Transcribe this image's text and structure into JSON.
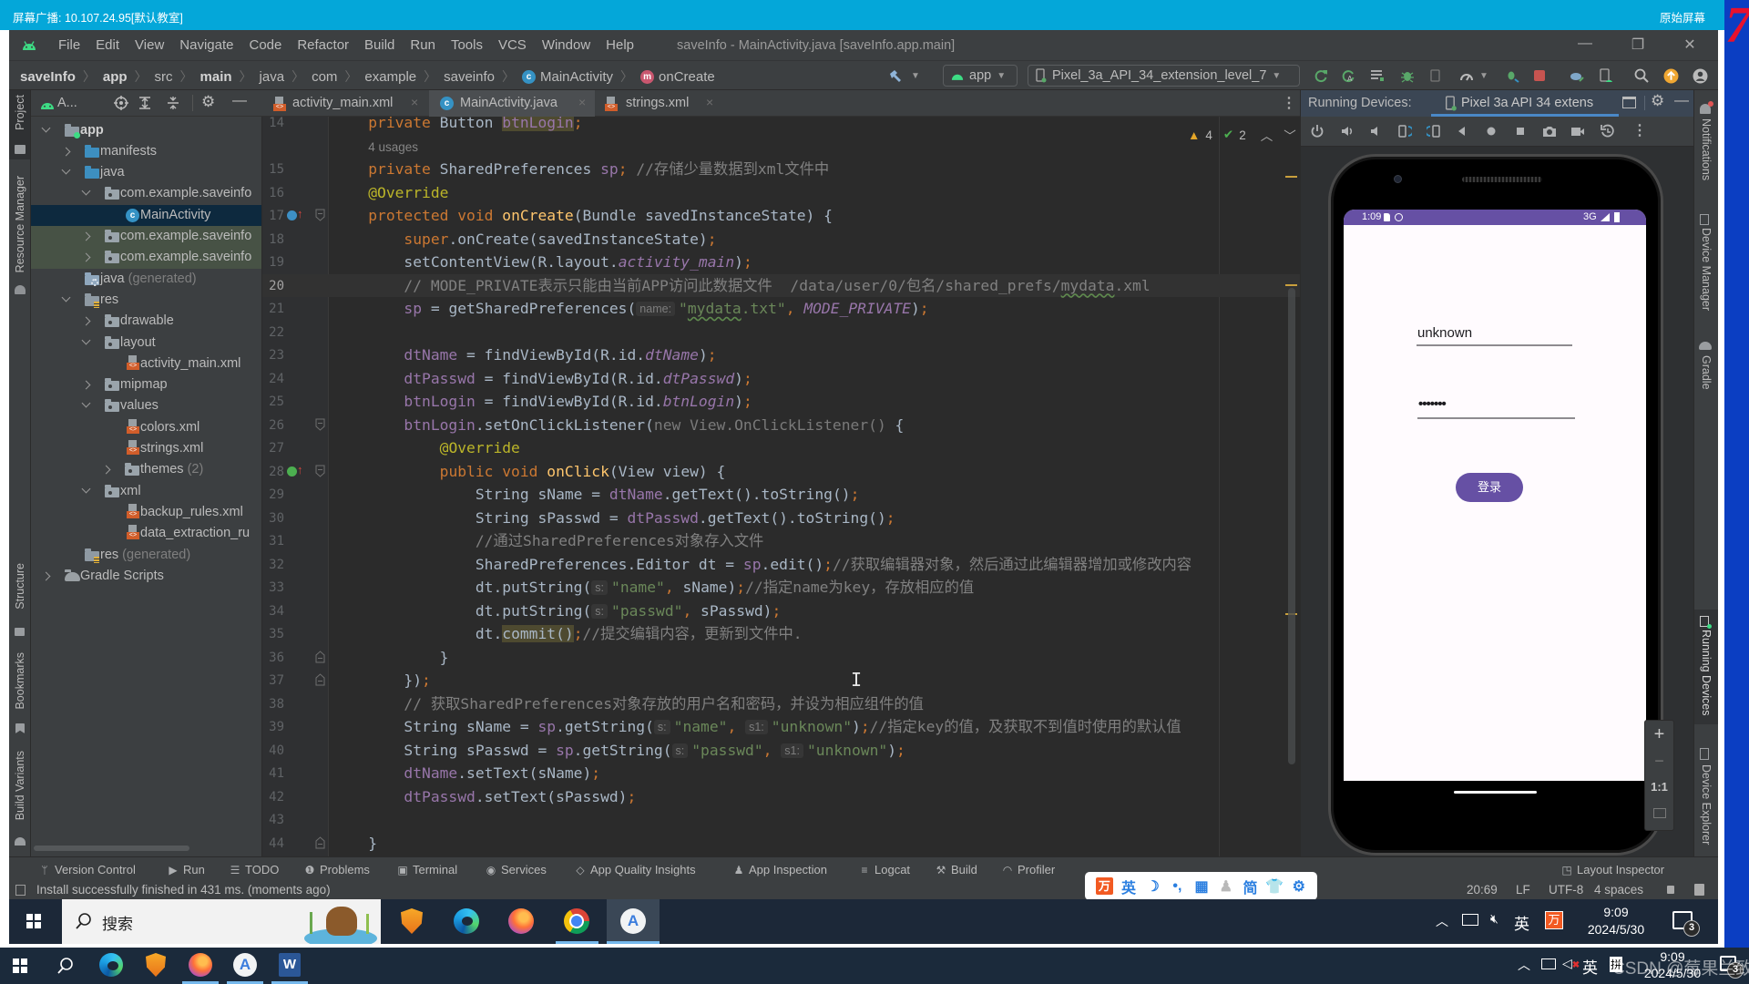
{
  "colors": {
    "phone_accent": "#6650a4"
  },
  "broadcast_bar": {
    "title": "屏幕广播: 10.107.24.95[默认教室]",
    "original_screen": "原始屏幕",
    "corner_number": "7"
  },
  "menu": {
    "items": [
      "File",
      "Edit",
      "View",
      "Navigate",
      "Code",
      "Refactor",
      "Build",
      "Run",
      "Tools",
      "VCS",
      "Window",
      "Help"
    ],
    "window_title": "saveInfo - MainActivity.java [saveInfo.app.main]"
  },
  "breadcrumb": [
    {
      "label": "saveInfo",
      "bold": true
    },
    {
      "label": "app",
      "bold": true
    },
    {
      "label": "src"
    },
    {
      "label": "main",
      "bold": true
    },
    {
      "label": "java"
    },
    {
      "label": "com"
    },
    {
      "label": "example"
    },
    {
      "label": "saveinfo"
    },
    {
      "label": "MainActivity",
      "icon": "c"
    },
    {
      "label": "onCreate",
      "icon": "m"
    }
  ],
  "toolbar": {
    "run_config": "app",
    "device": "Pixel_3a_API_34_extension_level_7"
  },
  "left_tools": [
    "Project",
    "Resource Manager",
    "Structure",
    "Bookmarks",
    "Build Variants"
  ],
  "project": {
    "view_label": "A...",
    "tree": [
      {
        "label": "app",
        "depth": 0,
        "arrow": "open",
        "icon": "module",
        "bold": true
      },
      {
        "label": "manifests",
        "depth": 1,
        "arrow": "closed",
        "icon": "folder-src"
      },
      {
        "label": "java",
        "depth": 1,
        "arrow": "open",
        "icon": "folder-src"
      },
      {
        "label": "com.example.saveinfo",
        "depth": 2,
        "arrow": "open",
        "icon": "package"
      },
      {
        "label": "MainActivity",
        "depth": 3,
        "icon": "class",
        "selected": true
      },
      {
        "label": "com.example.saveinfo",
        "depth": 2,
        "arrow": "closed",
        "icon": "package",
        "test": true
      },
      {
        "label": "com.example.saveinfo",
        "depth": 2,
        "arrow": "closed",
        "icon": "package",
        "test": true
      },
      {
        "label": "java",
        "suffix": " (generated)",
        "depth": 1,
        "icon": "folder-gen"
      },
      {
        "label": "res",
        "depth": 1,
        "arrow": "open",
        "icon": "folder-res"
      },
      {
        "label": "drawable",
        "depth": 2,
        "arrow": "closed",
        "icon": "package"
      },
      {
        "label": "layout",
        "depth": 2,
        "arrow": "open",
        "icon": "package"
      },
      {
        "label": "activity_main.xml",
        "depth": 3,
        "icon": "xml"
      },
      {
        "label": "mipmap",
        "depth": 2,
        "arrow": "closed",
        "icon": "package"
      },
      {
        "label": "values",
        "depth": 2,
        "arrow": "open",
        "icon": "package"
      },
      {
        "label": "colors.xml",
        "depth": 3,
        "icon": "xml"
      },
      {
        "label": "strings.xml",
        "depth": 3,
        "icon": "xml"
      },
      {
        "label": "themes",
        "suffix": " (2)",
        "depth": 3,
        "arrow": "closed",
        "icon": "package"
      },
      {
        "label": "xml",
        "depth": 2,
        "arrow": "open",
        "icon": "package"
      },
      {
        "label": "backup_rules.xml",
        "depth": 3,
        "icon": "xml"
      },
      {
        "label": "data_extraction_ru",
        "depth": 3,
        "icon": "xml"
      },
      {
        "label": "res",
        "suffix": " (generated)",
        "depth": 1,
        "icon": "folder-res"
      },
      {
        "label": "Gradle Scripts",
        "depth": 0,
        "arrow": "closed",
        "icon": "gradle"
      }
    ]
  },
  "editor": {
    "tabs": [
      {
        "label": "activity_main.xml",
        "icon": "xml",
        "active": false
      },
      {
        "label": "MainActivity.java",
        "icon": "class",
        "active": true
      },
      {
        "label": "strings.xml",
        "icon": "xml",
        "active": false
      }
    ],
    "inspections": {
      "warnings": "4",
      "weak_warnings": "2"
    },
    "lines": [
      {
        "n": "14",
        "indent": 4,
        "tokens": [
          [
            "kw",
            "private"
          ],
          [
            "pl",
            " Button "
          ],
          [
            "fld hl",
            "btnLogin"
          ],
          [
            "semi",
            ";"
          ]
        ]
      },
      {
        "n": "",
        "indent": 4,
        "usage": "4 usages"
      },
      {
        "n": "15",
        "indent": 4,
        "tokens": [
          [
            "kw",
            "private"
          ],
          [
            "pl",
            " SharedPreferences "
          ],
          [
            "fld",
            "sp"
          ],
          [
            "semi",
            ";"
          ],
          [
            "cm",
            " //存储少量数据到xml文件中"
          ]
        ]
      },
      {
        "n": "16",
        "indent": 4,
        "tokens": [
          [
            "ann",
            "@Override"
          ]
        ]
      },
      {
        "n": "17",
        "indent": 4,
        "gutter": "override",
        "fold": "start",
        "tokens": [
          [
            "kw",
            "protected void "
          ],
          [
            "fn",
            "onCreate"
          ],
          [
            "pl",
            "(Bundle savedInstanceState) {"
          ]
        ]
      },
      {
        "n": "18",
        "indent": 8,
        "tokens": [
          [
            "kw",
            "super"
          ],
          [
            "pl",
            ".onCreate(savedInstanceState)"
          ],
          [
            "semi",
            ";"
          ]
        ]
      },
      {
        "n": "19",
        "indent": 8,
        "tokens": [
          [
            "pl",
            "setContentView(R.layout."
          ],
          [
            "fldi",
            "activity_main"
          ],
          [
            "pl",
            ")"
          ],
          [
            "semi",
            ";"
          ]
        ]
      },
      {
        "n": "20",
        "indent": 8,
        "current": true,
        "tokens": [
          [
            "cm",
            "// MODE_PRIVATE表示只能由当前APP访问此数据文件  /data/user/0/包名/shared_prefs/"
          ],
          [
            "cm wavy",
            "mydata"
          ],
          [
            "cm",
            ".xml"
          ]
        ]
      },
      {
        "n": "21",
        "indent": 8,
        "tokens": [
          [
            "fld",
            "sp"
          ],
          [
            "pl",
            " = getSharedPreferences("
          ],
          [
            "hint",
            "name:"
          ],
          [
            "str",
            "\""
          ],
          [
            "str wavy",
            "mydata"
          ],
          [
            "str",
            ".txt\""
          ],
          [
            "semi",
            ","
          ],
          [
            "pl",
            " "
          ],
          [
            "cst",
            "MODE_PRIVATE"
          ],
          [
            "pl",
            ")"
          ],
          [
            "semi",
            ";"
          ]
        ]
      },
      {
        "n": "22",
        "indent": 0,
        "tokens": []
      },
      {
        "n": "23",
        "indent": 8,
        "tokens": [
          [
            "fld",
            "dtName"
          ],
          [
            "pl",
            " = findViewById(R.id."
          ],
          [
            "fldi",
            "dtName"
          ],
          [
            "pl",
            ")"
          ],
          [
            "semi",
            ";"
          ]
        ]
      },
      {
        "n": "24",
        "indent": 8,
        "tokens": [
          [
            "fld",
            "dtPasswd"
          ],
          [
            "pl",
            " = findViewById(R.id."
          ],
          [
            "fldi",
            "dtPasswd"
          ],
          [
            "pl",
            ")"
          ],
          [
            "semi",
            ";"
          ]
        ]
      },
      {
        "n": "25",
        "indent": 8,
        "tokens": [
          [
            "fld",
            "btnLogin"
          ],
          [
            "pl",
            " = findViewById(R.id."
          ],
          [
            "fldi",
            "btnLogin"
          ],
          [
            "pl",
            ")"
          ],
          [
            "semi",
            ";"
          ]
        ]
      },
      {
        "n": "26",
        "indent": 8,
        "fold": "start",
        "tokens": [
          [
            "fld",
            "btnLogin"
          ],
          [
            "pl",
            ".setOnClickListener("
          ],
          [
            "dim",
            "new View.OnClickListener()"
          ],
          [
            "pl",
            " {"
          ]
        ]
      },
      {
        "n": "27",
        "indent": 12,
        "tokens": [
          [
            "ann",
            "@Override"
          ]
        ]
      },
      {
        "n": "28",
        "indent": 12,
        "gutter": "implement",
        "fold": "start",
        "tokens": [
          [
            "kw",
            "public void "
          ],
          [
            "fn",
            "onClick"
          ],
          [
            "pl",
            "(View view) {"
          ]
        ]
      },
      {
        "n": "29",
        "indent": 16,
        "tokens": [
          [
            "pl",
            "String sName = "
          ],
          [
            "fld",
            "dtName"
          ],
          [
            "pl",
            ".getText().toString()"
          ],
          [
            "semi",
            ";"
          ]
        ]
      },
      {
        "n": "30",
        "indent": 16,
        "tokens": [
          [
            "pl",
            "String sPasswd = "
          ],
          [
            "fld",
            "dtPasswd"
          ],
          [
            "pl",
            ".getText().toString()"
          ],
          [
            "semi",
            ";"
          ]
        ]
      },
      {
        "n": "31",
        "indent": 16,
        "tokens": [
          [
            "cm",
            "//通过SharedPreferences对象存入文件"
          ]
        ]
      },
      {
        "n": "32",
        "indent": 16,
        "tokens": [
          [
            "pl",
            "SharedPreferences.Editor dt = "
          ],
          [
            "fld",
            "sp"
          ],
          [
            "pl",
            ".edit()"
          ],
          [
            "semi",
            ";"
          ],
          [
            "cm",
            "//获取编辑器对象，然后通过此编辑器增加或修改内容"
          ]
        ]
      },
      {
        "n": "33",
        "indent": 16,
        "tokens": [
          [
            "pl",
            "dt.putString("
          ],
          [
            "hint",
            "s:"
          ],
          [
            "str",
            "\"name\""
          ],
          [
            "semi",
            ","
          ],
          [
            "pl",
            " sName)"
          ],
          [
            "semi",
            ";"
          ],
          [
            "cm",
            "//指定name为key，存放相应的值"
          ]
        ]
      },
      {
        "n": "34",
        "indent": 16,
        "tokens": [
          [
            "pl",
            "dt.putString("
          ],
          [
            "hint",
            "s:"
          ],
          [
            "str",
            "\"passwd\""
          ],
          [
            "semi",
            ","
          ],
          [
            "pl",
            " sPasswd)"
          ],
          [
            "semi",
            ";"
          ]
        ]
      },
      {
        "n": "35",
        "indent": 16,
        "tokens": [
          [
            "pl",
            "dt."
          ],
          [
            "pl hl",
            "commit()"
          ],
          [
            "semi",
            ";"
          ],
          [
            "cm",
            "//提交编辑内容，更新到文件中."
          ]
        ]
      },
      {
        "n": "36",
        "indent": 12,
        "fold": "end",
        "tokens": [
          [
            "pl",
            "}"
          ]
        ]
      },
      {
        "n": "37",
        "indent": 8,
        "fold": "end",
        "tokens": [
          [
            "pl",
            "})"
          ],
          [
            "semi",
            ";"
          ]
        ]
      },
      {
        "n": "38",
        "indent": 8,
        "tokens": [
          [
            "cm",
            "// 获取SharedPreferences对象存放的用户名和密码，并设为相应组件的值"
          ]
        ]
      },
      {
        "n": "39",
        "indent": 8,
        "tokens": [
          [
            "pl",
            "String sName = "
          ],
          [
            "fld",
            "sp"
          ],
          [
            "pl",
            ".getString("
          ],
          [
            "hint",
            "s:"
          ],
          [
            "str",
            "\"name\""
          ],
          [
            "semi",
            ","
          ],
          [
            "pl",
            " "
          ],
          [
            "hint",
            "s1:"
          ],
          [
            "str",
            "\"unknown\""
          ],
          [
            "pl",
            ")"
          ],
          [
            "semi",
            ";"
          ],
          [
            "cm",
            "//指定key的值，及获取不到值时使用的默认值"
          ]
        ]
      },
      {
        "n": "40",
        "indent": 8,
        "tokens": [
          [
            "pl",
            "String sPasswd = "
          ],
          [
            "fld",
            "sp"
          ],
          [
            "pl",
            ".getString("
          ],
          [
            "hint",
            "s:"
          ],
          [
            "str",
            "\"passwd\""
          ],
          [
            "semi",
            ","
          ],
          [
            "pl",
            " "
          ],
          [
            "hint",
            "s1:"
          ],
          [
            "str",
            "\"unknown\""
          ],
          [
            "pl",
            ")"
          ],
          [
            "semi",
            ";"
          ]
        ]
      },
      {
        "n": "41",
        "indent": 8,
        "tokens": [
          [
            "fld",
            "dtName"
          ],
          [
            "pl",
            ".setText(sName)"
          ],
          [
            "semi",
            ";"
          ]
        ]
      },
      {
        "n": "42",
        "indent": 8,
        "tokens": [
          [
            "fld",
            "dtPasswd"
          ],
          [
            "pl",
            ".setText(sPasswd)"
          ],
          [
            "semi",
            ";"
          ]
        ]
      },
      {
        "n": "43",
        "indent": 0,
        "tokens": []
      },
      {
        "n": "44",
        "indent": 4,
        "fold": "end",
        "tokens": [
          [
            "pl",
            "}"
          ]
        ]
      }
    ]
  },
  "running_devices": {
    "title": "Running Devices:",
    "device_tab": "Pixel 3a API 34 extens",
    "zoom": {
      "in": "+",
      "out": "−",
      "actual": "1:1"
    },
    "phone": {
      "status_time": "1:09",
      "network": "3G",
      "username": "unknown",
      "password_masked": "•••••••",
      "login_button": "登录"
    }
  },
  "right_tools": [
    "Notifications",
    "Device Manager",
    "Gradle",
    "Running Devices",
    "Device Explorer"
  ],
  "tool_windows": [
    "Version Control",
    "Run",
    "TODO",
    "Problems",
    "Terminal",
    "Services",
    "App Quality Insights",
    "App Inspection",
    "Logcat",
    "Build",
    "Profiler",
    "Layout Inspector"
  ],
  "status": {
    "message": "Install successfully finished in 431 ms. (moments ago)",
    "position": "20:69",
    "line_sep": "LF",
    "encoding": "UTF-8",
    "indent": "4 spaces"
  },
  "ime": {
    "logo": "万",
    "mode": "英",
    "script": "简"
  },
  "inner_taskbar": {
    "search_placeholder": "搜索",
    "ime": "英",
    "ime_logo": "万",
    "time": "9:09",
    "date": "2024/5/30",
    "notifications": "3"
  },
  "outer_taskbar": {
    "ime": "英",
    "ime2": "拼",
    "time": "9:09",
    "date": "2024/5/30",
    "notifications": "3",
    "watermark": "CSDN @莓果兰致"
  }
}
